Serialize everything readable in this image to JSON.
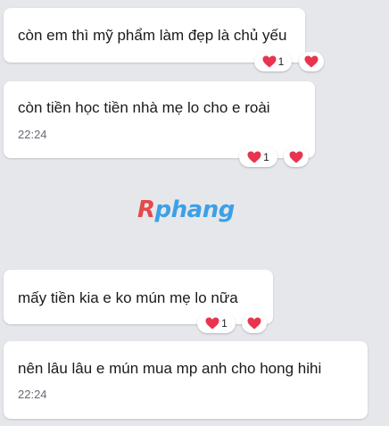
{
  "messages": [
    {
      "text": "còn em thì mỹ phẩm làm đẹp là chủ yếu",
      "time": "",
      "reactions": {
        "count": "1"
      }
    },
    {
      "text": "còn tiền học tiền nhà mẹ lo cho e roài",
      "time": "22:24",
      "reactions": {
        "count": "1"
      }
    },
    {
      "text": "mấy tiền kia e ko mún mẹ lo nữa",
      "time": "",
      "reactions": {
        "count": "1"
      }
    },
    {
      "text": "nên lâu lâu e mún mua mp anh cho hong hihi",
      "time": "22:24",
      "reactions": {
        "count": ""
      }
    }
  ],
  "watermark": {
    "part1": "R",
    "part2": "phang"
  },
  "colors": {
    "background": "#e5e7eb",
    "bubble": "#ffffff",
    "heart": "#e8344e",
    "watermark_red": "#e34a4a",
    "watermark_blue": "#3ca0e6"
  },
  "icons": {
    "reaction": "heart-icon"
  }
}
